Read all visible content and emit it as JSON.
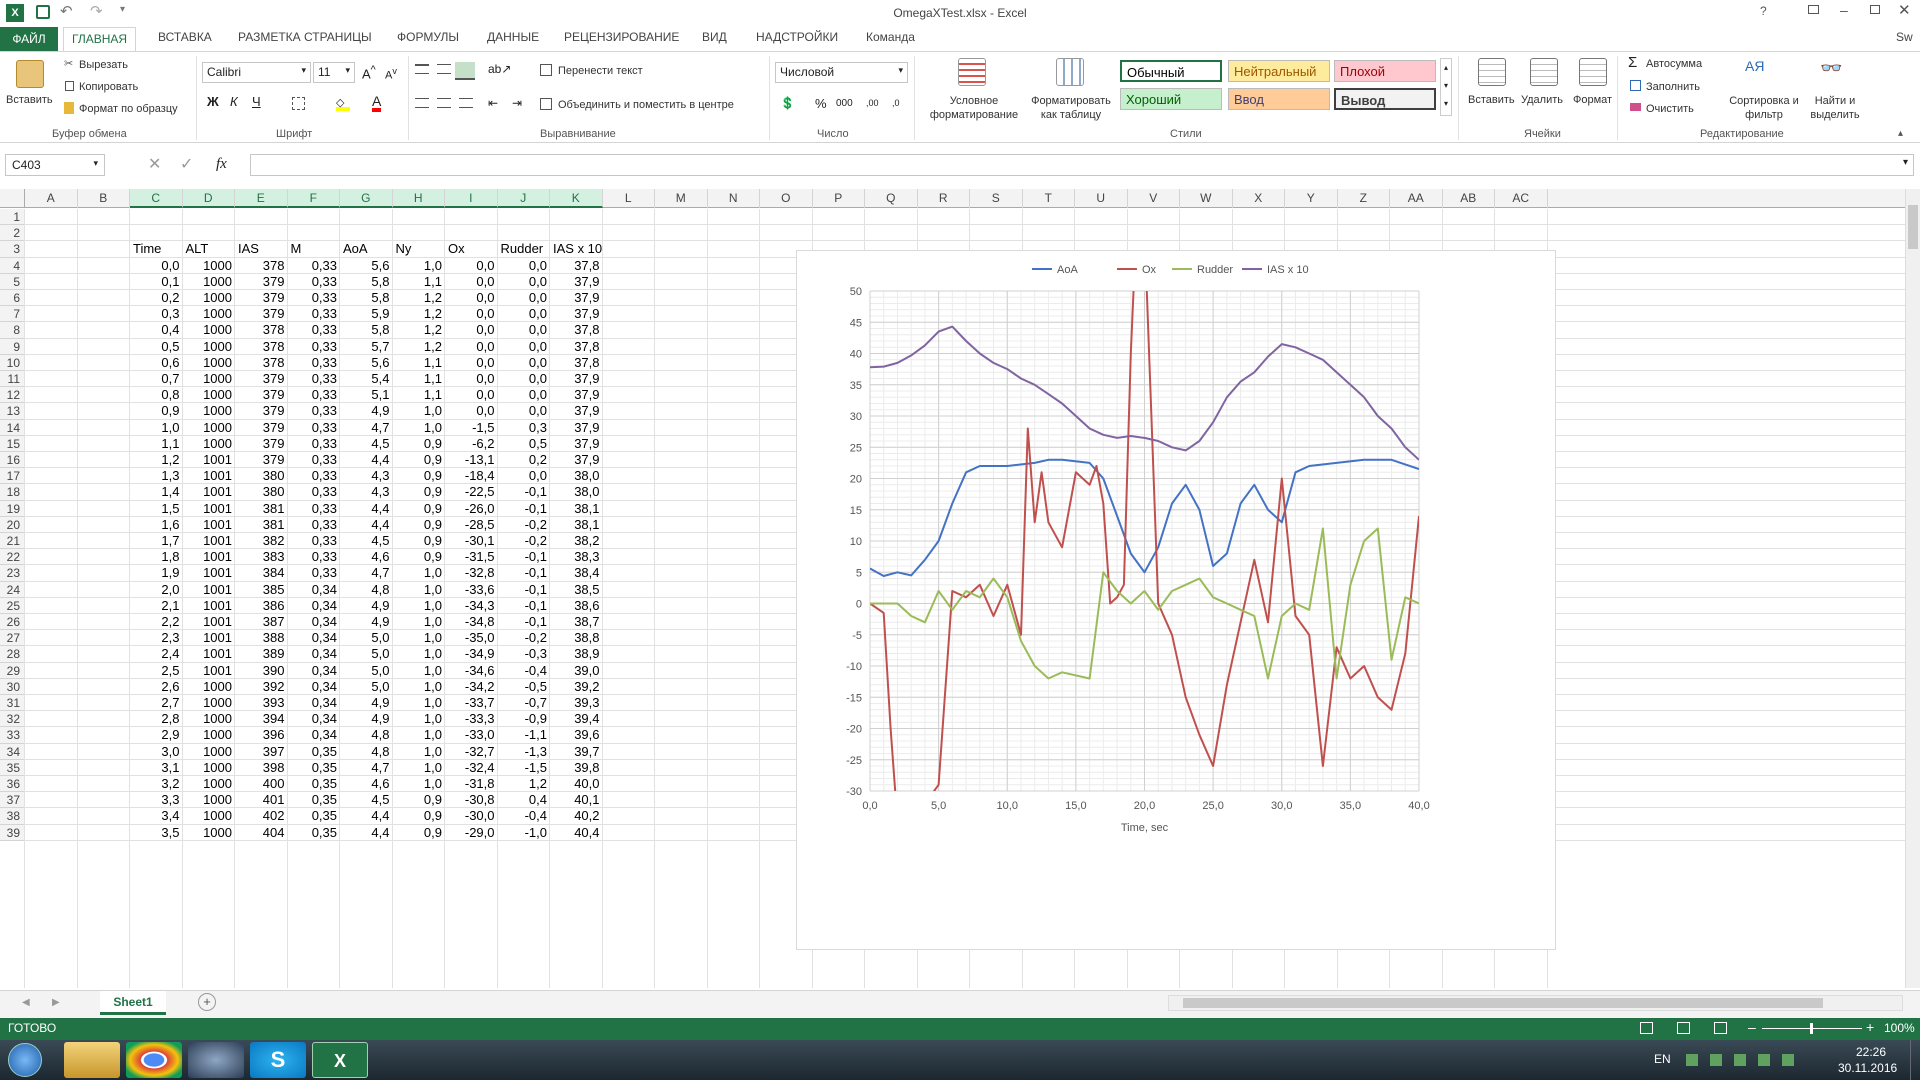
{
  "window": {
    "title": "OmegaXTest.xlsx - Excel",
    "help": "?",
    "user": "Sw"
  },
  "tabs": [
    "ФАЙЛ",
    "ГЛАВНАЯ",
    "ВСТАВКА",
    "РАЗМЕТКА СТРАНИЦЫ",
    "ФОРМУЛЫ",
    "ДАННЫЕ",
    "РЕЦЕНЗИРОВАНИЕ",
    "ВИД",
    "НАДСТРОЙКИ",
    "Команда"
  ],
  "ribbon": {
    "paste": "Вставить",
    "cut": "Вырезать",
    "copy": "Копировать",
    "format_painter": "Формат по образцу",
    "clipboard_group": "Буфер обмена",
    "font_name": "Calibri",
    "font_size": "11",
    "font_group": "Шрифт",
    "wrap_text": "Перенести текст",
    "merge_center": "Объединить и поместить в центре",
    "align_group": "Выравнивание",
    "number_format": "Числовой",
    "number_group": "Число",
    "cond_format": "Условное форматирование",
    "format_table": "Форматировать как таблицу",
    "styles_group": "Стили",
    "styles": [
      {
        "label": "Обычный",
        "bg": "#ffffff",
        "fg": "#000000"
      },
      {
        "label": "Нейтральный",
        "bg": "#ffeb9c",
        "fg": "#9c5700"
      },
      {
        "label": "Плохой",
        "bg": "#ffc7ce",
        "fg": "#9c0006"
      },
      {
        "label": "Хороший",
        "bg": "#c6efce",
        "fg": "#006100"
      },
      {
        "label": "Ввод",
        "bg": "#ffcc99",
        "fg": "#3f3f76"
      },
      {
        "label": "Вывод",
        "bg": "#f2f2f2",
        "fg": "#3f3f3f"
      }
    ],
    "insert": "Вставить",
    "delete": "Удалить",
    "format": "Формат",
    "cells_group": "Ячейки",
    "autosum": "Автосумма",
    "fill": "Заполнить",
    "clear": "Очистить",
    "sort_filter": "Сортировка и фильтр",
    "find_select": "Найти и выделить",
    "edit_group": "Редактирование"
  },
  "formula_bar": {
    "name_box": "C403",
    "fx": "fx",
    "formula": ""
  },
  "columns": [
    "A",
    "B",
    "C",
    "D",
    "E",
    "F",
    "G",
    "H",
    "I",
    "J",
    "K",
    "L",
    "M",
    "N",
    "O",
    "P",
    "Q",
    "R",
    "S",
    "T",
    "U",
    "V",
    "W",
    "X",
    "Y",
    "Z",
    "AA",
    "AB",
    "AC"
  ],
  "rows": [
    "1",
    "2",
    "3",
    "4",
    "5",
    "6",
    "7",
    "8",
    "9",
    "10",
    "11",
    "12",
    "13",
    "14",
    "15",
    "16",
    "17",
    "18",
    "19",
    "20",
    "21",
    "22",
    "23",
    "24",
    "25",
    "26",
    "27",
    "28",
    "29",
    "30",
    "31",
    "32",
    "33",
    "34",
    "35",
    "36",
    "37",
    "38",
    "39"
  ],
  "table": {
    "headers": [
      "Time",
      "ALT",
      "IAS",
      "M",
      "AoA",
      "Ny",
      "Ox",
      "Rudder",
      "IAS x 10"
    ],
    "rows": [
      [
        "0,0",
        "1000",
        "378",
        "0,33",
        "5,6",
        "1,0",
        "0,0",
        "0,0",
        "37,8"
      ],
      [
        "0,1",
        "1000",
        "379",
        "0,33",
        "5,8",
        "1,1",
        "0,0",
        "0,0",
        "37,9"
      ],
      [
        "0,2",
        "1000",
        "379",
        "0,33",
        "5,8",
        "1,2",
        "0,0",
        "0,0",
        "37,9"
      ],
      [
        "0,3",
        "1000",
        "379",
        "0,33",
        "5,9",
        "1,2",
        "0,0",
        "0,0",
        "37,9"
      ],
      [
        "0,4",
        "1000",
        "378",
        "0,33",
        "5,8",
        "1,2",
        "0,0",
        "0,0",
        "37,8"
      ],
      [
        "0,5",
        "1000",
        "378",
        "0,33",
        "5,7",
        "1,2",
        "0,0",
        "0,0",
        "37,8"
      ],
      [
        "0,6",
        "1000",
        "378",
        "0,33",
        "5,6",
        "1,1",
        "0,0",
        "0,0",
        "37,8"
      ],
      [
        "0,7",
        "1000",
        "379",
        "0,33",
        "5,4",
        "1,1",
        "0,0",
        "0,0",
        "37,9"
      ],
      [
        "0,8",
        "1000",
        "379",
        "0,33",
        "5,1",
        "1,1",
        "0,0",
        "0,0",
        "37,9"
      ],
      [
        "0,9",
        "1000",
        "379",
        "0,33",
        "4,9",
        "1,0",
        "0,0",
        "0,0",
        "37,9"
      ],
      [
        "1,0",
        "1000",
        "379",
        "0,33",
        "4,7",
        "1,0",
        "-1,5",
        "0,3",
        "37,9"
      ],
      [
        "1,1",
        "1000",
        "379",
        "0,33",
        "4,5",
        "0,9",
        "-6,2",
        "0,5",
        "37,9"
      ],
      [
        "1,2",
        "1001",
        "379",
        "0,33",
        "4,4",
        "0,9",
        "-13,1",
        "0,2",
        "37,9"
      ],
      [
        "1,3",
        "1001",
        "380",
        "0,33",
        "4,3",
        "0,9",
        "-18,4",
        "0,0",
        "38,0"
      ],
      [
        "1,4",
        "1001",
        "380",
        "0,33",
        "4,3",
        "0,9",
        "-22,5",
        "-0,1",
        "38,0"
      ],
      [
        "1,5",
        "1001",
        "381",
        "0,33",
        "4,4",
        "0,9",
        "-26,0",
        "-0,1",
        "38,1"
      ],
      [
        "1,6",
        "1001",
        "381",
        "0,33",
        "4,4",
        "0,9",
        "-28,5",
        "-0,2",
        "38,1"
      ],
      [
        "1,7",
        "1001",
        "382",
        "0,33",
        "4,5",
        "0,9",
        "-30,1",
        "-0,2",
        "38,2"
      ],
      [
        "1,8",
        "1001",
        "383",
        "0,33",
        "4,6",
        "0,9",
        "-31,5",
        "-0,1",
        "38,3"
      ],
      [
        "1,9",
        "1001",
        "384",
        "0,33",
        "4,7",
        "1,0",
        "-32,8",
        "-0,1",
        "38,4"
      ],
      [
        "2,0",
        "1001",
        "385",
        "0,34",
        "4,8",
        "1,0",
        "-33,6",
        "-0,1",
        "38,5"
      ],
      [
        "2,1",
        "1001",
        "386",
        "0,34",
        "4,9",
        "1,0",
        "-34,3",
        "-0,1",
        "38,6"
      ],
      [
        "2,2",
        "1001",
        "387",
        "0,34",
        "4,9",
        "1,0",
        "-34,8",
        "-0,1",
        "38,7"
      ],
      [
        "2,3",
        "1001",
        "388",
        "0,34",
        "5,0",
        "1,0",
        "-35,0",
        "-0,2",
        "38,8"
      ],
      [
        "2,4",
        "1001",
        "389",
        "0,34",
        "5,0",
        "1,0",
        "-34,9",
        "-0,3",
        "38,9"
      ],
      [
        "2,5",
        "1001",
        "390",
        "0,34",
        "5,0",
        "1,0",
        "-34,6",
        "-0,4",
        "39,0"
      ],
      [
        "2,6",
        "1000",
        "392",
        "0,34",
        "5,0",
        "1,0",
        "-34,2",
        "-0,5",
        "39,2"
      ],
      [
        "2,7",
        "1000",
        "393",
        "0,34",
        "4,9",
        "1,0",
        "-33,7",
        "-0,7",
        "39,3"
      ],
      [
        "2,8",
        "1000",
        "394",
        "0,34",
        "4,9",
        "1,0",
        "-33,3",
        "-0,9",
        "39,4"
      ],
      [
        "2,9",
        "1000",
        "396",
        "0,34",
        "4,8",
        "1,0",
        "-33,0",
        "-1,1",
        "39,6"
      ],
      [
        "3,0",
        "1000",
        "397",
        "0,35",
        "4,8",
        "1,0",
        "-32,7",
        "-1,3",
        "39,7"
      ],
      [
        "3,1",
        "1000",
        "398",
        "0,35",
        "4,7",
        "1,0",
        "-32,4",
        "-1,5",
        "39,8"
      ],
      [
        "3,2",
        "1000",
        "400",
        "0,35",
        "4,6",
        "1,0",
        "-31,8",
        "1,2",
        "40,0"
      ],
      [
        "3,3",
        "1000",
        "401",
        "0,35",
        "4,5",
        "0,9",
        "-30,8",
        "0,4",
        "40,1"
      ],
      [
        "3,4",
        "1000",
        "402",
        "0,35",
        "4,4",
        "0,9",
        "-30,0",
        "-0,4",
        "40,2"
      ],
      [
        "3,5",
        "1000",
        "404",
        "0,35",
        "4,4",
        "0,9",
        "-29,0",
        "-1,0",
        "40,4"
      ]
    ]
  },
  "chart_data": {
    "type": "line",
    "xlabel": "Time, sec",
    "ylabel": "",
    "xlim": [
      0,
      40
    ],
    "ylim": [
      -30,
      50
    ],
    "xticks": [
      "0,0",
      "5,0",
      "10,0",
      "15,0",
      "20,0",
      "25,0",
      "30,0",
      "35,0",
      "40,0"
    ],
    "yticks": [
      "50",
      "45",
      "40",
      "35",
      "30",
      "25",
      "20",
      "15",
      "10",
      "5",
      "0",
      "-5",
      "-10",
      "-15",
      "-20",
      "-25",
      "-30"
    ],
    "legend_position": "top",
    "grid": true,
    "series": [
      {
        "name": "AoA",
        "color": "#4472c4",
        "x": [
          0,
          1,
          2,
          3,
          4,
          5,
          6,
          7,
          8,
          10,
          12,
          13,
          14,
          16,
          17,
          18,
          19,
          20,
          21,
          22,
          23,
          24,
          25,
          26,
          27,
          28,
          29,
          30,
          31,
          32,
          34,
          36,
          38,
          40
        ],
        "y": [
          5.6,
          4.4,
          5,
          4.5,
          7,
          10,
          16,
          21,
          22,
          22,
          22.5,
          23,
          23,
          22.5,
          20,
          14,
          8,
          5,
          9,
          16,
          19,
          15,
          6,
          8,
          16,
          19,
          15,
          13,
          21,
          22,
          22.5,
          23,
          23,
          21.5
        ]
      },
      {
        "name": "Ox",
        "color": "#c0504d",
        "x": [
          0,
          1,
          1.5,
          2,
          3,
          4,
          5,
          6,
          7,
          8,
          9,
          10,
          11,
          11.5,
          12,
          12.5,
          13,
          14,
          15,
          16,
          16.5,
          17,
          17.5,
          18,
          18.5,
          19,
          19.5,
          20,
          20.5,
          21,
          22,
          23,
          24,
          25,
          26,
          27,
          28,
          29,
          30,
          31,
          32,
          33,
          34,
          35,
          36,
          37,
          38,
          39,
          40
        ],
        "y": [
          0,
          -1.5,
          -20,
          -35,
          -35,
          -32,
          -29,
          2,
          1,
          3,
          -2,
          3,
          -5,
          28,
          13,
          21,
          13,
          9,
          21,
          19,
          22,
          16,
          0,
          1,
          3,
          40,
          65,
          60,
          30,
          0,
          -5,
          -15,
          -21,
          -26,
          -13,
          -3,
          7,
          -3,
          20,
          -2,
          -5,
          -26,
          -7,
          -12,
          -10,
          -15,
          -17,
          -8,
          14
        ]
      },
      {
        "name": "Rudder",
        "color": "#9bbb59",
        "x": [
          0,
          2,
          3,
          4,
          5,
          6,
          7,
          8,
          9,
          10,
          11,
          12,
          13,
          14,
          16,
          17,
          18,
          19,
          20,
          21,
          22,
          23,
          24,
          25,
          26,
          27,
          28,
          29,
          30,
          31,
          32,
          33,
          34,
          35,
          36,
          37,
          38,
          39,
          40
        ],
        "y": [
          0,
          0,
          -2,
          -3,
          2,
          -1,
          2,
          1,
          4,
          1,
          -6,
          -10,
          -12,
          -11,
          -12,
          5,
          2,
          0,
          2,
          -1,
          2,
          3,
          4,
          1,
          0,
          -1,
          -2,
          -12,
          -2,
          0,
          -1,
          12,
          -12,
          3,
          10,
          12,
          -9,
          1,
          0
        ]
      },
      {
        "name": "IAS x 10",
        "color": "#8064a2",
        "x": [
          0,
          1,
          2,
          3,
          4,
          5,
          6,
          7,
          8,
          9,
          10,
          11,
          12,
          13,
          14,
          15,
          16,
          17,
          18,
          19,
          20,
          21,
          22,
          23,
          24,
          25,
          26,
          27,
          28,
          29,
          30,
          31,
          32,
          33,
          34,
          35,
          36,
          37,
          38,
          39,
          40
        ],
        "y": [
          37.8,
          37.9,
          38.5,
          39.7,
          41.3,
          43.5,
          44.3,
          42,
          40,
          38.5,
          37.5,
          36,
          35,
          33.5,
          32,
          30,
          28,
          27,
          26.5,
          26.8,
          26.5,
          26,
          25,
          24.5,
          26,
          29,
          33,
          35.5,
          37,
          39.5,
          41.5,
          41,
          40,
          39,
          37,
          35,
          33,
          30,
          28,
          25,
          23
        ]
      }
    ]
  },
  "sheet_tabs": {
    "active": "Sheet1",
    "add": "+"
  },
  "status": {
    "ready": "ГОТОВО",
    "zoom": "100%"
  },
  "taskbar": {
    "lang": "EN",
    "time": "22:26",
    "date": "30.11.2016"
  }
}
